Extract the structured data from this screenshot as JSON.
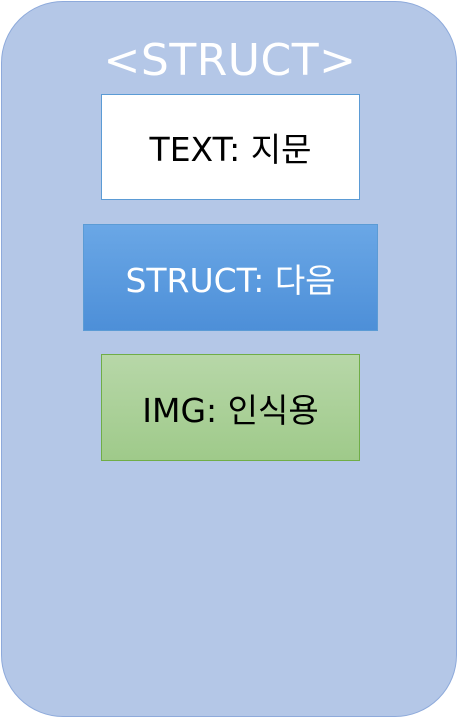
{
  "diagram": {
    "container_title": "<STRUCT>",
    "nodes": [
      {
        "label": "TEXT: 지문",
        "kind": "text"
      },
      {
        "label": "STRUCT: 다음",
        "kind": "struct"
      },
      {
        "label": "IMG: 인식용",
        "kind": "img"
      }
    ]
  },
  "colors": {
    "container_fill": "#b4c7e7",
    "container_border": "#8eaadb",
    "text_node_fill": "#ffffff",
    "text_node_border": "#5b9bd5",
    "struct_node_fill": "#5b9bd5",
    "img_node_fill": "#a9d18e",
    "img_node_border": "#70ad47"
  }
}
